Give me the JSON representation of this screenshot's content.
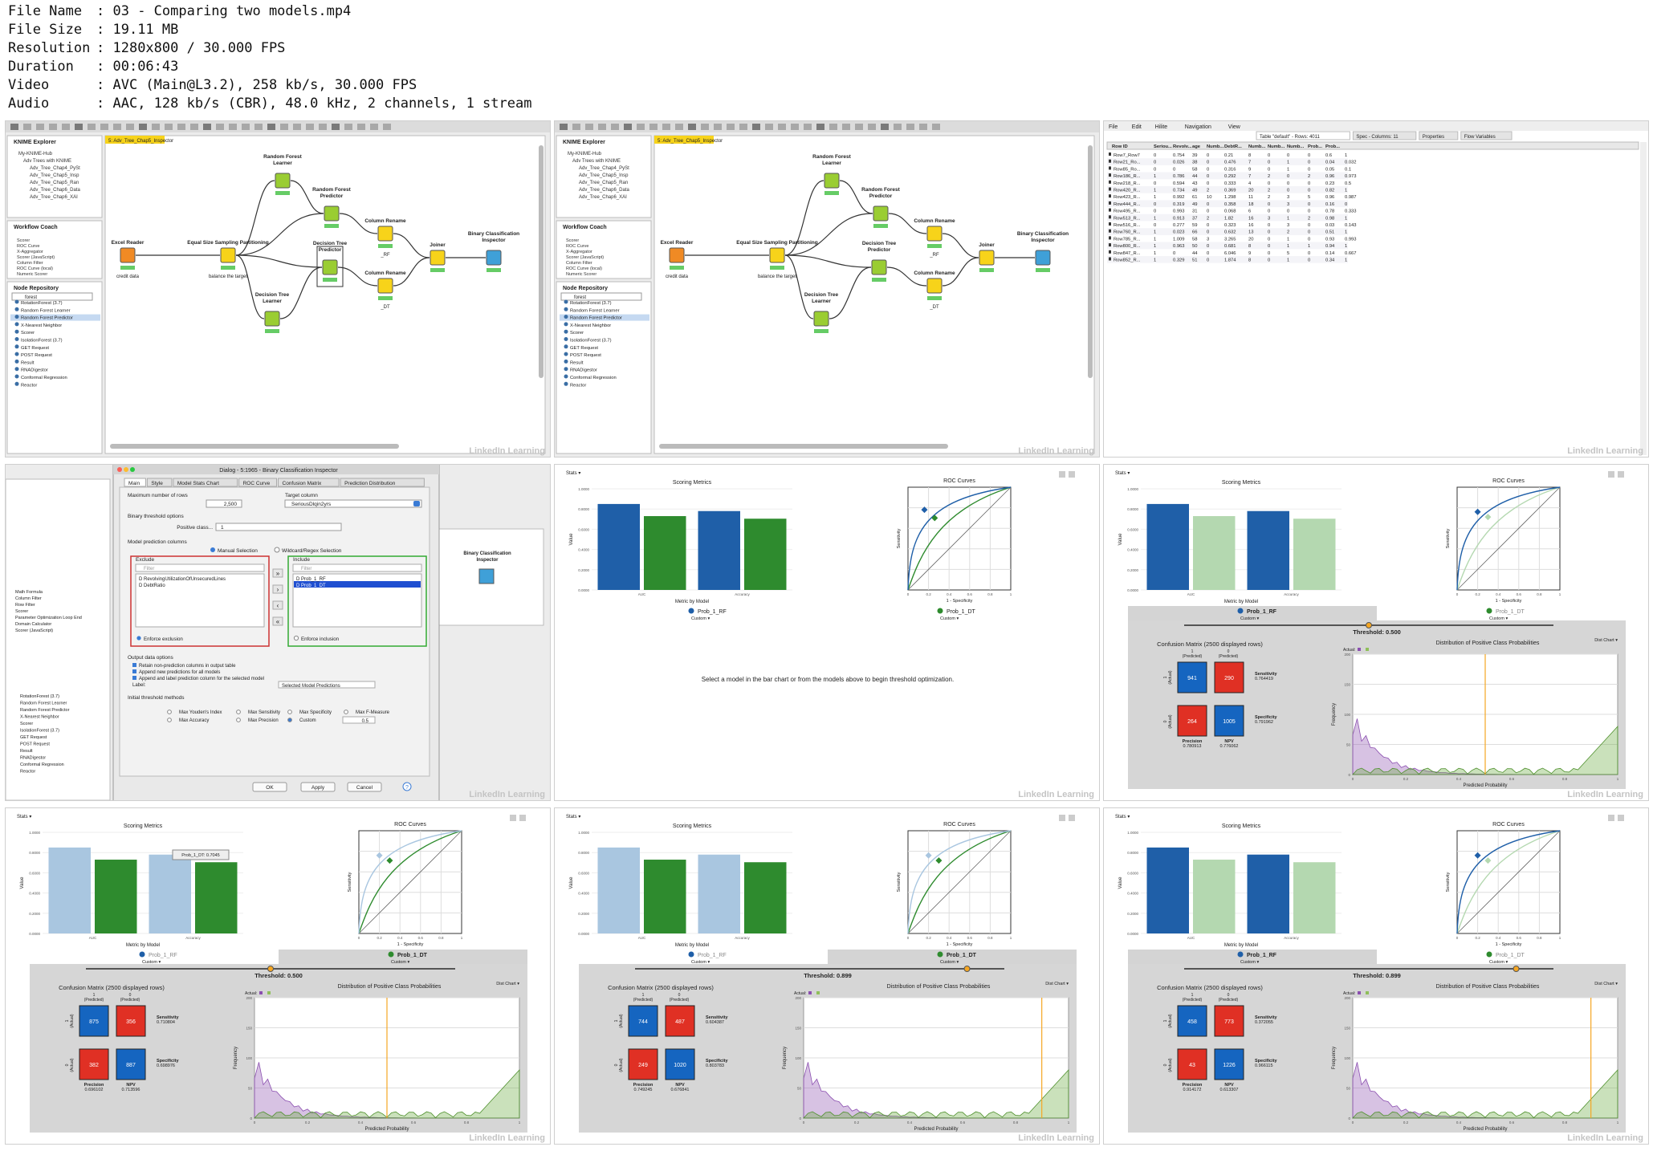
{
  "file_info": [
    {
      "key": "File Name",
      "value": "03 - Comparing two models.mp4"
    },
    {
      "key": "File Size",
      "value": "19.11 MB"
    },
    {
      "key": "Resolution",
      "value": "1280x800 / 30.000 FPS"
    },
    {
      "key": "Duration",
      "value": "00:06:43"
    },
    {
      "key": "Video",
      "value": "AVC (Main@L3.2), 258 kb/s, 30.000 FPS"
    },
    {
      "key": "Audio",
      "value": "AAC, 128 kb/s (CBR), 48.0 kHz, 2 channels, 1 stream"
    }
  ],
  "workflow": {
    "tab": "5: Adv_Tree_Chap5_Inspector",
    "explorer_title": "KNIME Explorer",
    "coach_title": "Workflow Coach",
    "repo_title": "Node Repository",
    "repo_search": "forest",
    "nodes": {
      "excel": "Excel Reader",
      "excel_sub": "credit data",
      "sampling": "Equal Size Sampling Partitioning",
      "sampling_sub": "balance the target",
      "rf_learner": "Random Forest Learner",
      "rf_predictor": "Random Forest Predictor",
      "dt_predictor": "Decision Tree Predictor",
      "dt_learner": "Decision Tree Learner",
      "rename1": "Column Rename",
      "rename1_sub": "_RF",
      "rename2": "Column Rename",
      "rename2_sub": "_DT",
      "joiner": "Joiner",
      "inspector": "Binary Classification Inspector"
    },
    "repo_items": [
      "RotationForest (3.7)",
      "Random Forest Learner",
      "Random Forest Predictor",
      "X-Nearest Neighbor",
      "Scorer",
      "IsolationForest (3.7)",
      "GET Request",
      "POST Request",
      "Result",
      "RNADigestor",
      "Conformal Regression",
      "Reactor"
    ]
  },
  "table": {
    "menu": [
      "File",
      "Edit",
      "Hilite",
      "Navigation",
      "View"
    ],
    "tabs": [
      "Table \"default\" - Rows: 4011",
      "Spec - Columns: 11",
      "Properties",
      "Flow Variables"
    ],
    "headers": [
      "Row ID",
      "Seriou...",
      "Revolv...",
      "age",
      "Numb...",
      "DebtR...",
      "Numb...",
      "Numb...",
      "Numb...",
      "Prob...",
      "Prob..."
    ],
    "rows": [
      [
        "Row7_Row7",
        "0",
        "0.754",
        "39",
        "0",
        "0.21",
        "8",
        "0",
        "0",
        "0",
        "0.6",
        "1"
      ],
      [
        "Row21_Ro...",
        "0",
        "0.026",
        "38",
        "0",
        "0.476",
        "7",
        "0",
        "1",
        "0",
        "0.04",
        "0.032"
      ],
      [
        "Row85_Ro...",
        "0",
        "0",
        "58",
        "0",
        "0.316",
        "9",
        "0",
        "1",
        "0",
        "0.05",
        "0.1"
      ],
      [
        "Row186_R...",
        "1",
        "0.786",
        "44",
        "0",
        "0.292",
        "7",
        "2",
        "0",
        "2",
        "0.96",
        "0.973"
      ],
      [
        "Row218_R...",
        "0",
        "0.594",
        "43",
        "0",
        "0.333",
        "4",
        "0",
        "0",
        "0",
        "0.23",
        "0.5"
      ],
      [
        "Row420_R...",
        "1",
        "0.734",
        "49",
        "2",
        "0.369",
        "20",
        "2",
        "0",
        "0",
        "0.82",
        "1"
      ],
      [
        "Row423_R...",
        "1",
        "0.992",
        "61",
        "10",
        "1.298",
        "11",
        "2",
        "3",
        "5",
        "0.96",
        "0.987"
      ],
      [
        "Row444_R...",
        "0",
        "0.319",
        "49",
        "0",
        "0.358",
        "18",
        "0",
        "3",
        "0",
        "0.16",
        "0"
      ],
      [
        "Row495_R...",
        "0",
        "0.993",
        "31",
        "0",
        "0.068",
        "6",
        "0",
        "0",
        "0",
        "0.78",
        "0.333"
      ],
      [
        "Row513_R...",
        "1",
        "0.913",
        "37",
        "2",
        "1.82",
        "16",
        "3",
        "1",
        "2",
        "0.98",
        "1"
      ],
      [
        "Row516_R...",
        "0",
        "0.277",
        "59",
        "0",
        "0.323",
        "16",
        "0",
        "3",
        "0",
        "0.03",
        "0.143"
      ],
      [
        "Row760_R...",
        "1",
        "0.023",
        "66",
        "0",
        "0.632",
        "13",
        "0",
        "2",
        "0",
        "0.51",
        "1"
      ],
      [
        "Row785_R...",
        "1",
        "1.009",
        "58",
        "3",
        "3.265",
        "20",
        "0",
        "1",
        "0",
        "0.93",
        "0.993"
      ],
      [
        "Row800_R...",
        "1",
        "0.963",
        "50",
        "0",
        "0.681",
        "8",
        "0",
        "1",
        "1",
        "0.94",
        "1"
      ],
      [
        "Row847_R...",
        "1",
        "0",
        "44",
        "0",
        "6.046",
        "9",
        "0",
        "5",
        "0",
        "0.14",
        "0.667"
      ],
      [
        "Row852_R...",
        "1",
        "0.329",
        "51",
        "0",
        "1.874",
        "8",
        "0",
        "1",
        "0",
        "0.34",
        "1"
      ]
    ]
  },
  "dialog": {
    "title": "Dialog - 5:1965 - Binary Classification Inspector",
    "tabs": [
      "Main",
      "Style",
      "Model Stats Chart",
      "ROC Curve",
      "Confusion Matrix",
      "Prediction Distribution"
    ],
    "max_rows_label": "Maximum number of rows",
    "max_rows_value": "2,500",
    "target_label": "Target column",
    "target_value": "SeriousDlqin2yrs",
    "threshold_label": "Binary threshold options",
    "positive_label": "Positive class...",
    "positive_value": "1",
    "model_cols_label": "Model prediction columns",
    "manual": "Manual Selection",
    "wildcard": "Wildcard/Regex Selection",
    "exclude": "Exclude",
    "include": "Include",
    "filter": "Filter",
    "exclude_items": [
      "RevolvingUtilizationOfUnsecuredLines",
      "DebtRatio"
    ],
    "include_items": [
      "Prob_1_RF",
      "Prob_1_DT"
    ],
    "enforce_exclusion": "Enforce exclusion",
    "enforce_inclusion": "Enforce inclusion",
    "output_label": "Output data options",
    "out1": "Retain non-prediction columns in output table",
    "out2": "Append new predictions for all models",
    "out3": "Append and label prediction column for the selected model",
    "label_label": "Label:",
    "label_value": "Selected Model Predictions",
    "init_label": "Initial threshold methods",
    "m1": "Max Youden's Index",
    "m2": "Max Sensitivity",
    "m3": "Max Specificity",
    "m4": "Max F-Measure",
    "m5": "Max Accuracy",
    "m6": "Max Precision",
    "m7": "Custom",
    "custom_value": "0.5",
    "ok": "OK",
    "apply": "Apply",
    "cancel": "Cancel"
  },
  "inspector": {
    "stats_menu": "Stats",
    "scoring_title": "Scoring Metrics",
    "roc_title": "ROC Curves",
    "y_label": "Value",
    "x_label": "Metric by Model",
    "roc_x": "1 - Specificity",
    "roc_y": "Sensitivity",
    "cat_auc": "AUC",
    "cat_acc": "Accuracy",
    "model_rf": "Prob_1_RF",
    "model_dt": "Prob_1_DT",
    "custom": "Custom",
    "hint": "Select a model in the bar chart or from the models above to begin threshold optimization.",
    "threshold_prefix": "Threshold: ",
    "cm_title": "Confusion Matrix (2500 displayed rows)",
    "dist_title": "Distribution of Positive Class Probabilities",
    "dist_menu": "Dist Chart",
    "predicted": "(Predicted)",
    "actual": "(Actual)",
    "frequency": "Frequency",
    "pred_prob": "Predicted Probability",
    "sensitivity": "Sensitivity",
    "specificity": "Specificity",
    "precision": "Precision",
    "npv": "NPV",
    "actual_legend": "Actual:",
    "tooltip": "Prob_1_DT: 0.7045",
    "y_ticks": [
      "1.0000",
      "0.8000",
      "0.6000",
      "0.4000",
      "0.2000",
      "0.0000"
    ],
    "roc_ticks": [
      "0",
      "0.2",
      "0.4",
      "0.6",
      "0.8",
      "1"
    ],
    "dist_yticks": [
      "200",
      "150",
      "100",
      "50",
      "0"
    ]
  },
  "panels": [
    {
      "threshold": "0.500",
      "tp": "941",
      "fn": "290",
      "fp": "264",
      "tn": "1005",
      "sens": "0.764419",
      "spec": "0.791962",
      "prec": "0.780913",
      "npv": "0.776062",
      "selected": "rf"
    },
    {
      "threshold": "0.500",
      "tp": "875",
      "fn": "356",
      "fp": "382",
      "tn": "887",
      "sens": "0.710804",
      "spec": "0.698976",
      "prec": "0.696102",
      "npv": "0.713596",
      "selected": "dt"
    },
    {
      "threshold": "0.899",
      "tp": "744",
      "fn": "487",
      "fp": "249",
      "tn": "1020",
      "sens": "0.604387",
      "spec": "0.803783",
      "prec": "0.749245",
      "npv": "0.676841",
      "selected": "dt"
    },
    {
      "threshold": "0.899",
      "tp": "458",
      "fn": "773",
      "fp": "43",
      "tn": "1226",
      "sens": "0.372055",
      "spec": "0.966115",
      "prec": "0.914172",
      "npv": "0.613307",
      "selected": "rf"
    }
  ],
  "chart_data": [
    {
      "type": "bar",
      "title": "Scoring Metrics",
      "xlabel": "Metric by Model",
      "ylabel": "Value",
      "categories": [
        "AUC",
        "Accuracy"
      ],
      "ylim": [
        0,
        1
      ],
      "series": [
        {
          "name": "Prob_1_RF",
          "values": [
            0.85,
            0.78
          ]
        },
        {
          "name": "Prob_1_DT",
          "values": [
            0.73,
            0.7045
          ]
        }
      ]
    }
  ],
  "colors": {
    "rf": "#1f5fa8",
    "dt": "#2e8b2e",
    "rf_light": "#a9c6e0",
    "dt_light": "#b4d8b0",
    "cm_blue": "#1565c0",
    "cm_red": "#e03024",
    "orange": "#f5a623",
    "knime_yellow": "#f7d31a"
  },
  "watermark": "LinkedIn Learning"
}
